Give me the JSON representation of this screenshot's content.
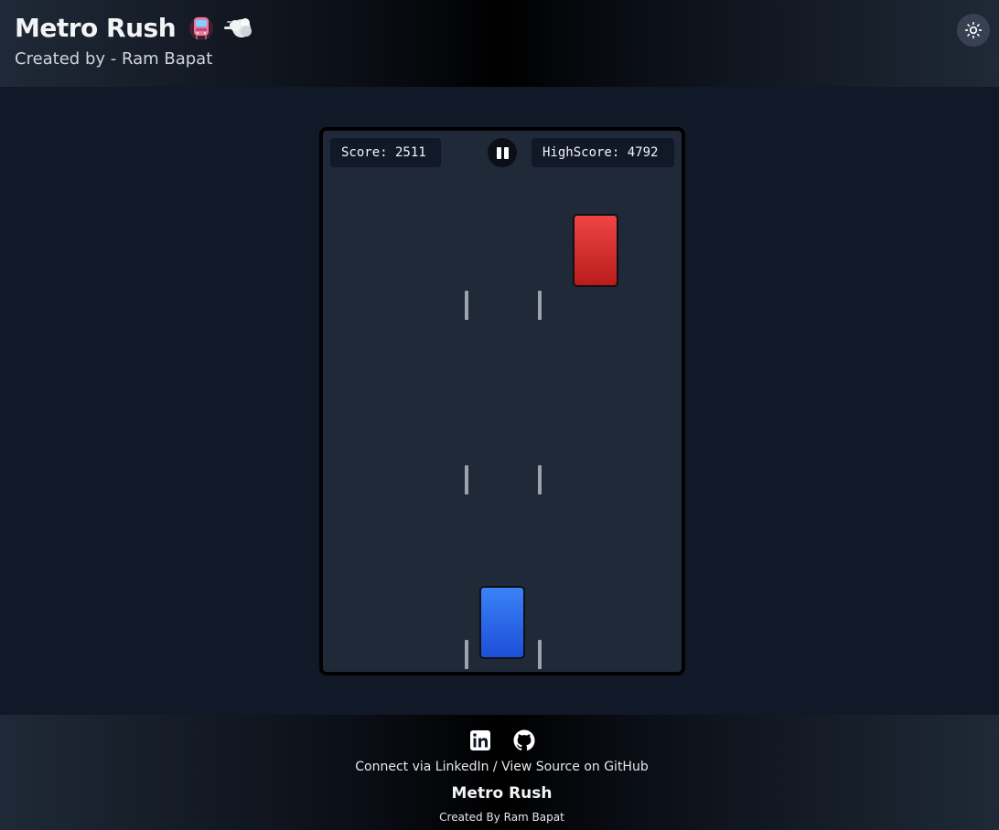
{
  "header": {
    "title": "Metro Rush",
    "title_icons": [
      "metro-train-icon",
      "dashing-away-icon"
    ],
    "subtitle": "Created by - Ram Bapat",
    "theme_toggle_icon": "sun-icon"
  },
  "game": {
    "score_label": "Score: 2511",
    "score": 2511,
    "high_score_label": "HighScore: 4792",
    "high_score": 4792,
    "pause_icon": "pause-icon",
    "obstacle_car_color": "#dc2626",
    "player_car_color": "#2563eb"
  },
  "footer": {
    "social_icons": [
      "linkedin-icon",
      "github-icon"
    ],
    "connect_text": "Connect via LinkedIn",
    "separator": " / ",
    "source_text": "View Source on GitHub",
    "title": "Metro Rush",
    "credit": "Created By Ram Bapat"
  },
  "colors": {
    "background": "#111827",
    "board": "#1f2937",
    "lane_marking": "#9ca3af"
  }
}
